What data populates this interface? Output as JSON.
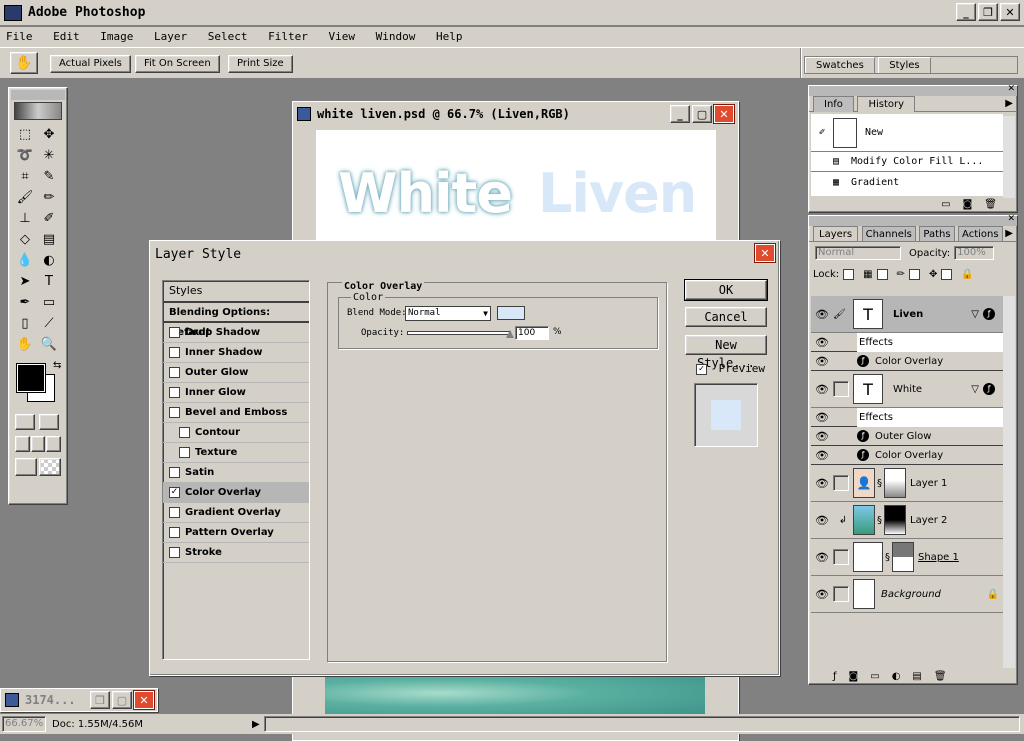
{
  "app": {
    "title": "Adobe Photoshop"
  },
  "menu": [
    "File",
    "Edit",
    "Image",
    "Layer",
    "Select",
    "Filter",
    "View",
    "Window",
    "Help"
  ],
  "options": {
    "actual": "Actual Pixels",
    "fit": "Fit On Screen",
    "print": "Print Size"
  },
  "swatches": {
    "tabs": [
      "Swatches",
      "Styles"
    ]
  },
  "doc": {
    "title": "white liven.psd @ 66.7% (Liven,RGB)",
    "word1": "White",
    "word2": "Liven",
    "status_zoom": "66.67%",
    "status_doc": "Doc: 1.55M/4.56M"
  },
  "minwin": {
    "title": "3174..."
  },
  "dialog": {
    "title": "Layer Style",
    "styles_header": "Styles",
    "blending": "Blending Options: Default",
    "items": [
      {
        "label": "Drop Shadow",
        "checked": false
      },
      {
        "label": "Inner Shadow",
        "checked": false
      },
      {
        "label": "Outer Glow",
        "checked": false
      },
      {
        "label": "Inner Glow",
        "checked": false
      },
      {
        "label": "Bevel and Emboss",
        "checked": false
      },
      {
        "label": "Contour",
        "checked": false
      },
      {
        "label": "Texture",
        "checked": false
      },
      {
        "label": "Satin",
        "checked": false
      },
      {
        "label": "Color Overlay",
        "checked": true
      },
      {
        "label": "Gradient Overlay",
        "checked": false
      },
      {
        "label": "Pattern Overlay",
        "checked": false
      },
      {
        "label": "Stroke",
        "checked": false
      }
    ],
    "section": "Color Overlay",
    "group": "Color",
    "blend_label": "Blend Mode:",
    "blend_value": "Normal",
    "opacity_label": "Opacity:",
    "opacity_value": "100",
    "pct": "%",
    "ok": "OK",
    "cancel": "Cancel",
    "newstyle": "New Style...",
    "preview": "Preview",
    "overlay_color": "#d8e8f8"
  },
  "history": {
    "tabs": [
      "Info",
      "History"
    ],
    "new": "New",
    "items": [
      "Modify Color Fill L...",
      "Gradient"
    ]
  },
  "layers": {
    "tabs": [
      "Layers",
      "Channels",
      "Paths",
      "Actions"
    ],
    "mode": "Normal",
    "opacity_label": "Opacity:",
    "opacity": "100%",
    "lock": "Lock:",
    "liven": "Liven",
    "white": "White",
    "effects": "Effects",
    "color_overlay": "Color Overlay",
    "outer_glow": "Outer Glow",
    "layer1": "Layer 1",
    "layer2": "Layer 2",
    "shape1": "Shape 1",
    "background": "Background"
  }
}
